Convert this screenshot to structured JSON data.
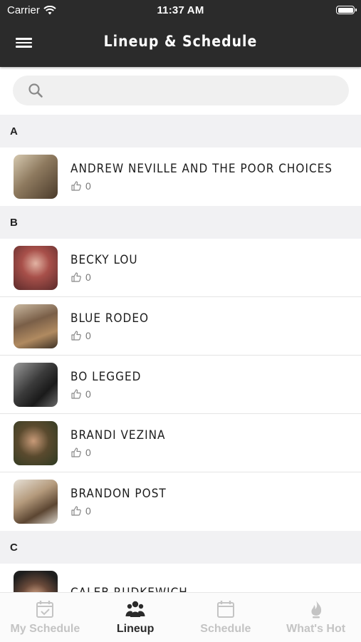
{
  "status_bar": {
    "carrier": "Carrier",
    "time": "11:37 AM"
  },
  "header": {
    "title": "Lineup & Schedule",
    "menu_icon": "hamburger-menu-icon"
  },
  "search": {
    "placeholder": "",
    "value": "",
    "icon": "search-icon"
  },
  "sections": [
    {
      "letter": "A",
      "artists": [
        {
          "name": "Andrew Neville and the Poor Choices",
          "likes": "0"
        }
      ]
    },
    {
      "letter": "B",
      "artists": [
        {
          "name": "Becky Lou",
          "likes": "0"
        },
        {
          "name": "Blue Rodeo",
          "likes": "0"
        },
        {
          "name": "Bo Legged",
          "likes": "0"
        },
        {
          "name": "Brandi Vezina",
          "likes": "0"
        },
        {
          "name": "Brandon Post",
          "likes": "0"
        }
      ]
    },
    {
      "letter": "C",
      "artists": [
        {
          "name": "Caleb Rudkewich",
          "likes": ""
        }
      ]
    }
  ],
  "tabs": [
    {
      "label": "My Schedule",
      "icon": "calendar-check-icon",
      "active": false
    },
    {
      "label": "Lineup",
      "icon": "group-icon",
      "active": true
    },
    {
      "label": "Schedule",
      "icon": "calendar-icon",
      "active": false
    },
    {
      "label": "What's Hot",
      "icon": "flame-icon",
      "active": false
    }
  ],
  "colors": {
    "header_bg": "#2b2b2b",
    "section_bg": "#f1f1f3",
    "tab_inactive": "#c4c4c4",
    "tab_active": "#2b2b2b"
  }
}
